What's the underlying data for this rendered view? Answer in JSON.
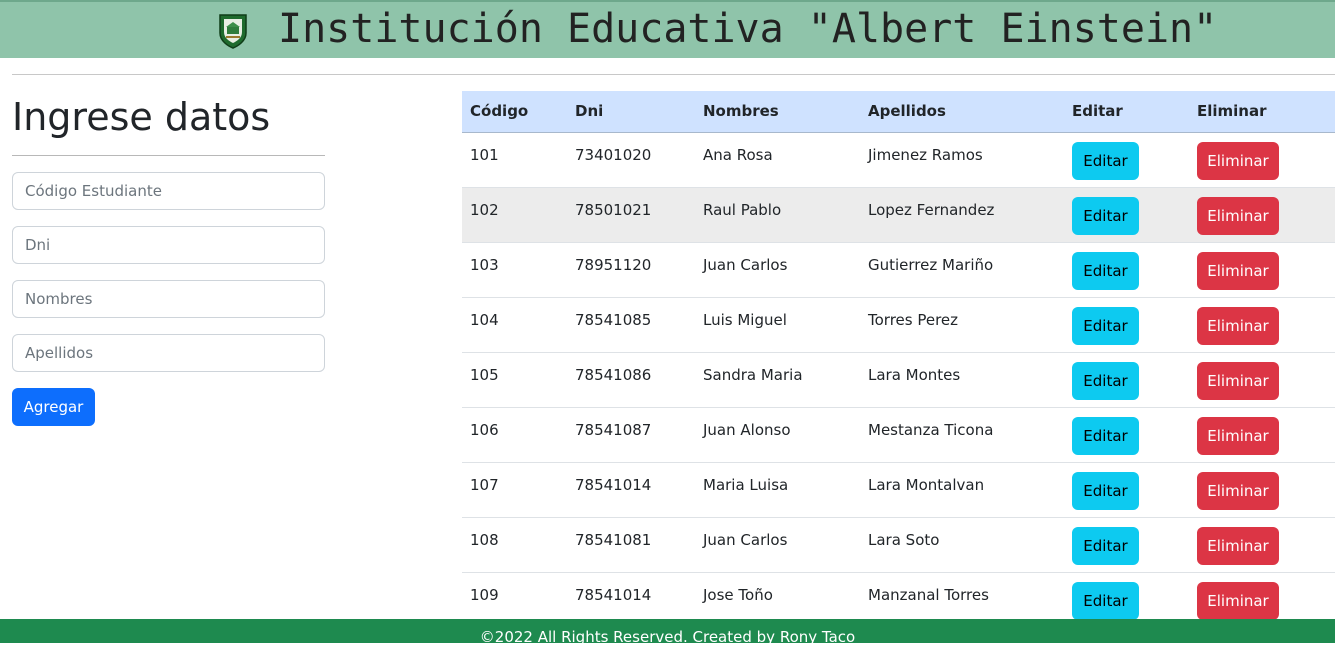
{
  "header": {
    "title": "Institución Educativa \"Albert Einstein\"",
    "logo_icon": "school-shield-icon",
    "background": "#8fc4aa"
  },
  "form": {
    "title": "Ingrese datos",
    "fields": {
      "codigo": {
        "placeholder": "Código Estudiante",
        "value": ""
      },
      "dni": {
        "placeholder": "Dni",
        "value": ""
      },
      "nombres": {
        "placeholder": "Nombres",
        "value": ""
      },
      "apellidos": {
        "placeholder": "Apellidos",
        "value": ""
      }
    },
    "submit_label": "Agregar",
    "submit_color": "#0d6efd"
  },
  "table": {
    "headers": [
      "Código",
      "Dni",
      "Nombres",
      "Apellidos",
      "Editar",
      "Eliminar"
    ],
    "edit_label": "Editar",
    "delete_label": "Eliminar",
    "edit_color": "#0dcaf0",
    "delete_color": "#dc3545",
    "rows": [
      {
        "codigo": "101",
        "dni": "73401020",
        "nombres": "Ana Rosa",
        "apellidos": "Jimenez Ramos"
      },
      {
        "codigo": "102",
        "dni": "78501021",
        "nombres": "Raul Pablo",
        "apellidos": "Lopez Fernandez"
      },
      {
        "codigo": "103",
        "dni": "78951120",
        "nombres": "Juan Carlos",
        "apellidos": "Gutierrez Mariño"
      },
      {
        "codigo": "104",
        "dni": "78541085",
        "nombres": "Luis Miguel",
        "apellidos": "Torres Perez"
      },
      {
        "codigo": "105",
        "dni": "78541086",
        "nombres": "Sandra Maria",
        "apellidos": "Lara Montes"
      },
      {
        "codigo": "106",
        "dni": "78541087",
        "nombres": "Juan Alonso",
        "apellidos": "Mestanza Ticona"
      },
      {
        "codigo": "107",
        "dni": "78541014",
        "nombres": "Maria Luisa",
        "apellidos": "Lara Montalvan"
      },
      {
        "codigo": "108",
        "dni": "78541081",
        "nombres": "Juan Carlos",
        "apellidos": "Lara Soto"
      },
      {
        "codigo": "109",
        "dni": "78541014",
        "nombres": "Jose Toño",
        "apellidos": "Manzanal Torres"
      }
    ]
  },
  "footer": {
    "text": "©2022 All Rights Reserved. Created by Rony Taco",
    "background": "#1e8a4f"
  }
}
